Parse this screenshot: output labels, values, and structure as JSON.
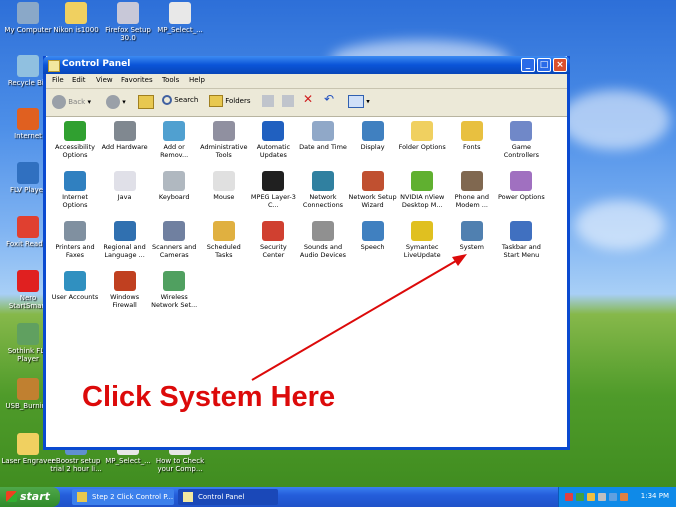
{
  "desktop": {
    "icons": [
      {
        "label": "My Computer",
        "icon": "computer-icon",
        "color": "#8aa8c8"
      },
      {
        "label": "Nikon is1000",
        "icon": "folder-icon",
        "color": "#f0d060"
      },
      {
        "label": "Firefox Setup 30.0",
        "icon": "installer-icon",
        "color": "#c8c8d8"
      },
      {
        "label": "MP_Select_...",
        "icon": "document-icon",
        "color": "#e8e8e8"
      },
      {
        "label": "Recycle Bin",
        "icon": "recycle-bin-icon",
        "color": "#90c0e0"
      },
      {
        "label": "Internet",
        "icon": "firefox-icon",
        "color": "#e06020"
      },
      {
        "label": "FLV Player",
        "icon": "flv-icon",
        "color": "#3070c0"
      },
      {
        "label": "Foxit Reader",
        "icon": "pdf-icon",
        "color": "#e04030"
      },
      {
        "label": "Nero StartSmart",
        "icon": "nero-icon",
        "color": "#e02020"
      },
      {
        "label": "Sothink FLV Player",
        "icon": "player-icon",
        "color": "#60a060"
      },
      {
        "label": "USB_Burning",
        "icon": "usb-icon",
        "color": "#c08030"
      },
      {
        "label": "Laser Engraver",
        "icon": "folder-icon",
        "color": "#f0d060"
      },
      {
        "label": "eBoostr setup trial 2 hour li...",
        "icon": "setup-icon",
        "color": "#6090d0"
      },
      {
        "label": "MP_Select_...",
        "icon": "document-icon",
        "color": "#e8e8e8"
      },
      {
        "label": "How to Check your Comp...",
        "icon": "document-icon",
        "color": "#e8e8e8"
      }
    ]
  },
  "window": {
    "title": "Control Panel",
    "menu": [
      "File",
      "Edit",
      "View",
      "Favorites",
      "Tools",
      "Help"
    ],
    "toolbar": {
      "back": "Back",
      "search": "Search",
      "folders": "Folders"
    },
    "items": [
      {
        "label": "Accessibility Options",
        "icon": "accessibility-icon",
        "color": "#30a030"
      },
      {
        "label": "Add Hardware",
        "icon": "hardware-icon",
        "color": "#808890"
      },
      {
        "label": "Add or Remov...",
        "icon": "add-remove-icon",
        "color": "#50a0d0"
      },
      {
        "label": "Administrative Tools",
        "icon": "admin-tools-icon",
        "color": "#9090a0"
      },
      {
        "label": "Automatic Updates",
        "icon": "updates-icon",
        "color": "#2060c0"
      },
      {
        "label": "Date and Time",
        "icon": "clock-icon",
        "color": "#90a8c8"
      },
      {
        "label": "Display",
        "icon": "display-icon",
        "color": "#4080c0"
      },
      {
        "label": "Folder Options",
        "icon": "folder-icon",
        "color": "#f0d060"
      },
      {
        "label": "Fonts",
        "icon": "fonts-icon",
        "color": "#e8c040"
      },
      {
        "label": "Game Controllers",
        "icon": "gamepad-icon",
        "color": "#7088c8"
      },
      {
        "label": "Internet Options",
        "icon": "globe-icon",
        "color": "#3080c0"
      },
      {
        "label": "Java",
        "icon": "java-icon",
        "color": "#e0e0e8"
      },
      {
        "label": "Keyboard",
        "icon": "keyboard-icon",
        "color": "#b0b8c0"
      },
      {
        "label": "Mouse",
        "icon": "mouse-icon",
        "color": "#e0e0e0"
      },
      {
        "label": "MPEG Layer-3 C...",
        "icon": "mpeg-icon",
        "color": "#202020"
      },
      {
        "label": "Network Connections",
        "icon": "network-icon",
        "color": "#3080a0"
      },
      {
        "label": "Network Setup Wizard",
        "icon": "network-wizard-icon",
        "color": "#c05030"
      },
      {
        "label": "NVIDIA nView Desktop M...",
        "icon": "nvidia-icon",
        "color": "#60b030"
      },
      {
        "label": "Phone and Modem ...",
        "icon": "phone-icon",
        "color": "#806850"
      },
      {
        "label": "Power Options",
        "icon": "power-icon",
        "color": "#a070c0"
      },
      {
        "label": "Printers and Faxes",
        "icon": "printer-icon",
        "color": "#8090a0"
      },
      {
        "label": "Regional and Language ...",
        "icon": "regional-icon",
        "color": "#3070b0"
      },
      {
        "label": "Scanners and Cameras",
        "icon": "scanner-icon",
        "color": "#7080a0"
      },
      {
        "label": "Scheduled Tasks",
        "icon": "tasks-icon",
        "color": "#e0b040"
      },
      {
        "label": "Security Center",
        "icon": "shield-icon",
        "color": "#d04030"
      },
      {
        "label": "Sounds and Audio Devices",
        "icon": "speaker-icon",
        "color": "#909090"
      },
      {
        "label": "Speech",
        "icon": "speech-icon",
        "color": "#4080c0"
      },
      {
        "label": "Symantec LiveUpdate",
        "icon": "liveupdate-icon",
        "color": "#e0c020"
      },
      {
        "label": "System",
        "icon": "system-icon",
        "color": "#5080b0"
      },
      {
        "label": "Taskbar and Start Menu",
        "icon": "taskbar-icon",
        "color": "#4070c0"
      },
      {
        "label": "User Accounts",
        "icon": "users-icon",
        "color": "#3090c0"
      },
      {
        "label": "Windows Firewall",
        "icon": "firewall-icon",
        "color": "#c04020"
      },
      {
        "label": "Wireless Network Set...",
        "icon": "wireless-icon",
        "color": "#50a060"
      }
    ]
  },
  "annotation": {
    "text": "Click System Here",
    "color": "#dc0a0a"
  },
  "taskbar": {
    "start": "start",
    "tasks": [
      "Step 2 Click Control P...",
      "Control Panel"
    ],
    "clock": "1:34 PM"
  }
}
